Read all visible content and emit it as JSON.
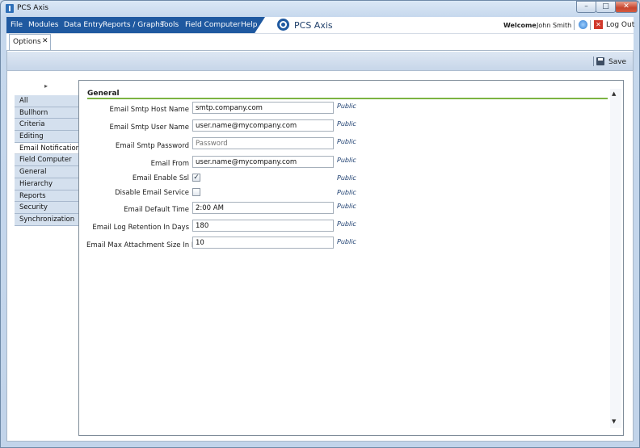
{
  "window": {
    "title": "PCS Axis",
    "minimize_icon": "minimize-icon",
    "maximize_icon": "maximize-icon",
    "close_icon": "close-icon"
  },
  "menu": {
    "items": [
      "File",
      "Modules",
      "Data Entry",
      "Reports / Graphs",
      "Tools",
      "Field Computer",
      "Help"
    ],
    "brand": "PCS Axis",
    "welcome": "Welcome",
    "user": "John Smith",
    "logout": "Log Out"
  },
  "tabs": {
    "active": "Options",
    "close_glyph": "✕"
  },
  "toolbar": {
    "save_label": "Save"
  },
  "nav": {
    "expand_glyph": "▸",
    "items": [
      "All",
      "Bullhorn",
      "Criteria",
      "Editing",
      "Email Notification",
      "Field Computer",
      "General",
      "Hierarchy",
      "Reports",
      "Security",
      "Synchronization"
    ],
    "active": "Email Notification"
  },
  "section": {
    "title": "General"
  },
  "fields": [
    {
      "label": "Email Smtp Host Name",
      "value": "smtp.company.com",
      "placeholder": "",
      "scope": "Public",
      "type": "text"
    },
    {
      "label": "Email Smtp User Name",
      "value": "user.name@mycompany.com",
      "placeholder": "",
      "scope": "Public",
      "type": "text"
    },
    {
      "label": "Email Smtp Password",
      "value": "",
      "placeholder": "Password",
      "scope": "Public",
      "type": "password"
    },
    {
      "label": "Email From",
      "value": "user.name@mycompany.com",
      "placeholder": "",
      "scope": "Public",
      "type": "text"
    },
    {
      "label": "Email Enable Ssl",
      "checked": true,
      "scope": "Public",
      "type": "checkbox"
    },
    {
      "label": "Disable Email Service",
      "checked": false,
      "scope": "Public",
      "type": "checkbox"
    },
    {
      "label": "Email Default Time",
      "value": "2:00 AM",
      "placeholder": "",
      "scope": "Public",
      "type": "text"
    },
    {
      "label": "Email Log Retention In Days",
      "value": "180",
      "placeholder": "",
      "scope": "Public",
      "type": "text"
    },
    {
      "label": "Email Max Attachment Size In Mb",
      "value": "10",
      "placeholder": "",
      "scope": "Public",
      "type": "text"
    }
  ],
  "check_glyph": "✓",
  "colors": {
    "menu_bar": "#1f59a0",
    "section_rule": "#7cb342",
    "nav_bg": "#d4e0ee",
    "scope_text": "#1a3c6e"
  }
}
